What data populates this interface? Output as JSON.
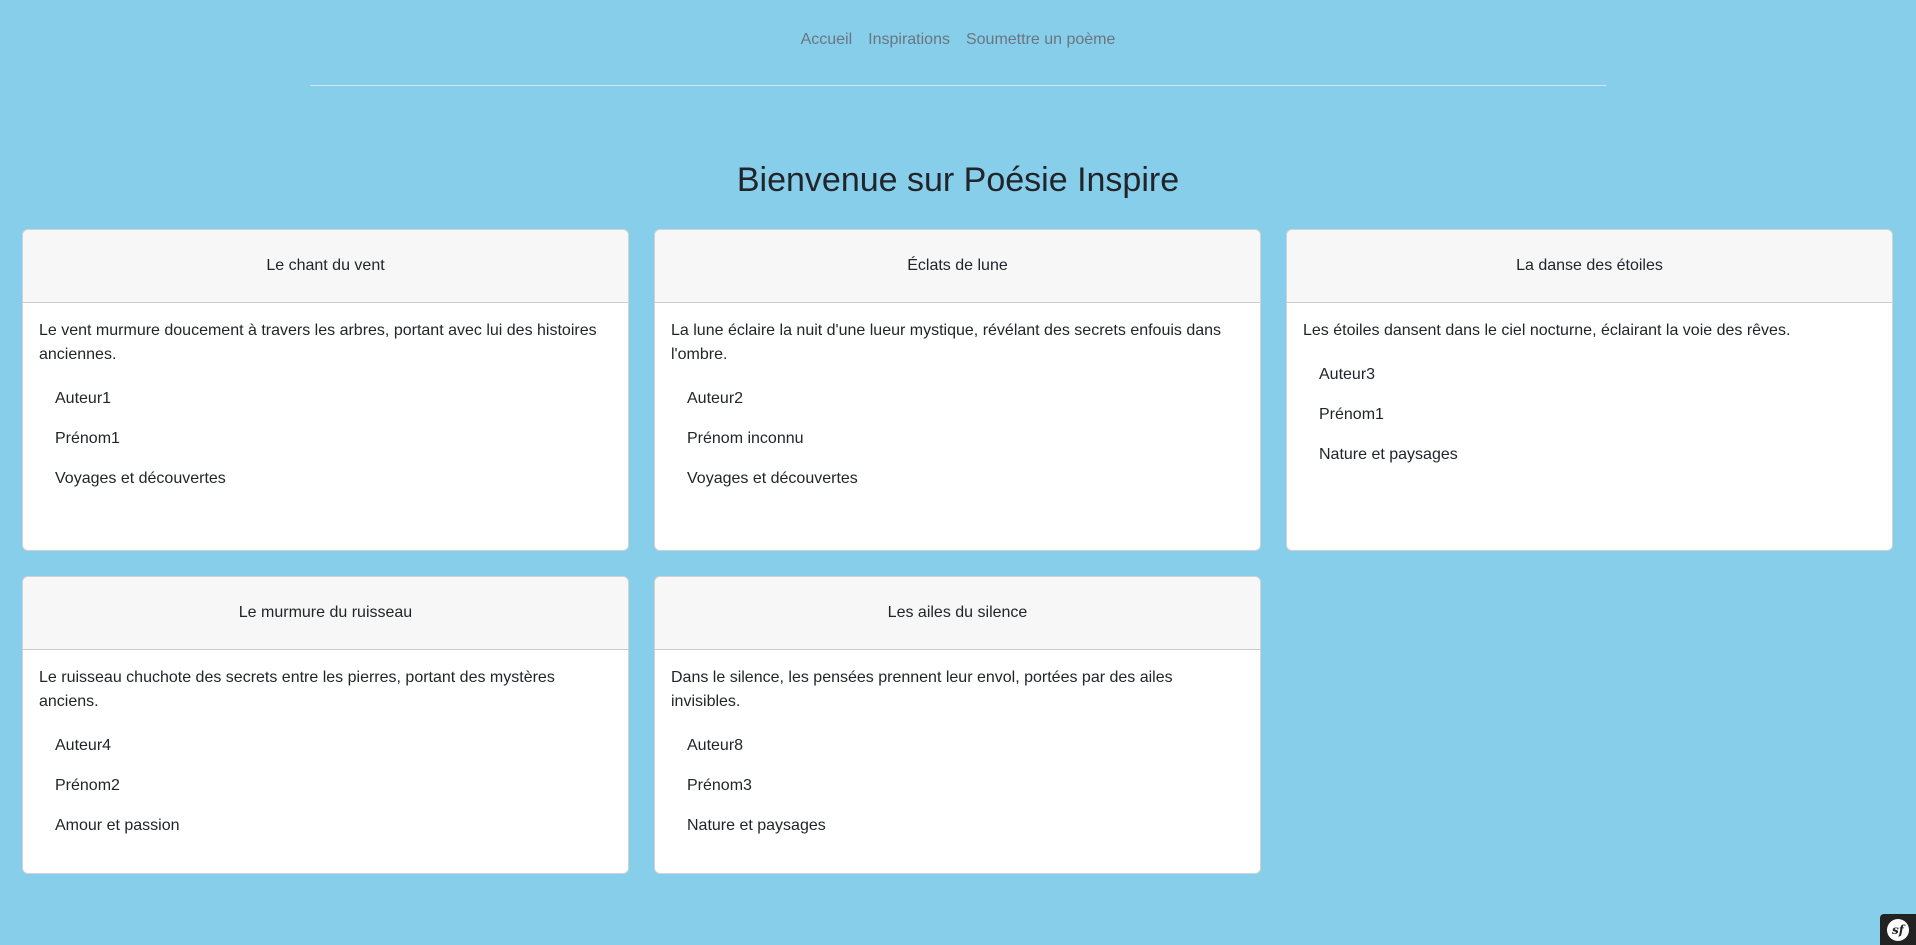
{
  "nav": {
    "items": [
      {
        "label": "Accueil"
      },
      {
        "label": "Inspirations"
      },
      {
        "label": "Soumettre un poème"
      }
    ]
  },
  "page": {
    "title": "Bienvenue sur Poésie Inspire"
  },
  "cards": [
    {
      "title": "Le chant du vent",
      "text": "Le vent murmure doucement à travers les arbres, portant avec lui des histoires anciennes.",
      "author": "Auteur1",
      "firstname": "Prénom1",
      "category": "Voyages et découvertes"
    },
    {
      "title": "Éclats de lune",
      "text": "La lune éclaire la nuit d'une lueur mystique, révélant des secrets enfouis dans l'ombre.",
      "author": "Auteur2",
      "firstname": "Prénom inconnu",
      "category": "Voyages et découvertes"
    },
    {
      "title": "La danse des étoiles",
      "text": "Les étoiles dansent dans le ciel nocturne, éclairant la voie des rêves.",
      "author": "Auteur3",
      "firstname": "Prénom1",
      "category": "Nature et paysages"
    },
    {
      "title": "Le murmure du ruisseau",
      "text": "Le ruisseau chuchote des secrets entre les pierres, portant des mystères anciens.",
      "author": "Auteur4",
      "firstname": "Prénom2",
      "category": "Amour et passion"
    },
    {
      "title": "Les ailes du silence",
      "text": "Dans le silence, les pensées prennent leur envol, portées par des ailes invisibles.",
      "author": "Auteur8",
      "firstname": "Prénom3",
      "category": "Nature et paysages"
    }
  ],
  "toolbar": {
    "badge_label": "sf",
    "icon": "symfony-icon"
  },
  "colors": {
    "background": "#87ceeb",
    "card_header": "#f7f7f7",
    "nav_link": "#6c757d"
  }
}
